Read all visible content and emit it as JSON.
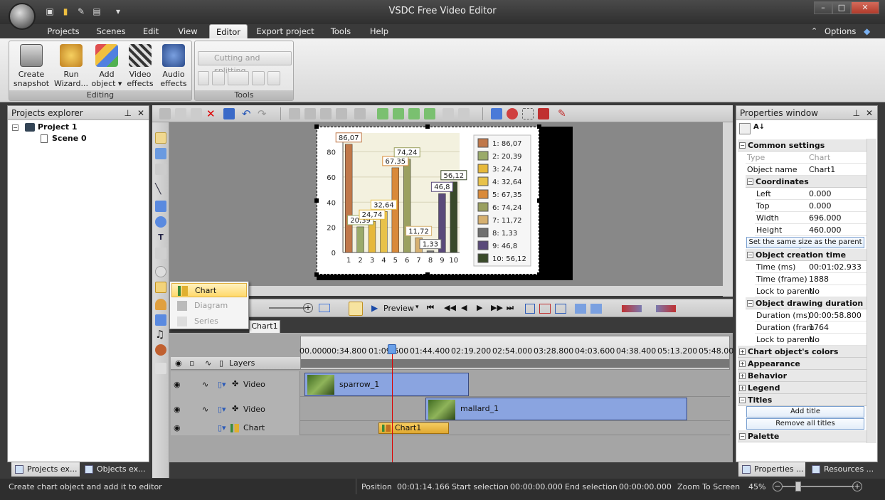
{
  "window": {
    "title": "VSDC Free Video Editor"
  },
  "menu": {
    "tabs": [
      "Projects",
      "Scenes",
      "Edit",
      "View",
      "Editor",
      "Export project",
      "Tools",
      "Help"
    ],
    "active": "Editor",
    "options": "Options"
  },
  "ribbon": {
    "editing_group": "Editing",
    "tools_group": "Tools",
    "create_snapshot": [
      "Create",
      "snapshot"
    ],
    "run_wizard": [
      "Run",
      "Wizard..."
    ],
    "add_object": [
      "Add",
      "object"
    ],
    "video_effects": [
      "Video",
      "effects"
    ],
    "audio_effects": [
      "Audio",
      "effects"
    ],
    "cutting_splitting": "Cutting and splitting"
  },
  "projects_explorer": {
    "title": "Projects explorer",
    "project": "Project 1",
    "scene": "Scene 0",
    "tabs": [
      "Projects ex...",
      "Objects ex..."
    ]
  },
  "popup_menu": {
    "items": [
      {
        "label": "Chart",
        "state": "highlighted"
      },
      {
        "label": "Diagram",
        "state": "disabled"
      },
      {
        "label": "Series",
        "state": "disabled"
      }
    ]
  },
  "chart_data": {
    "type": "bar",
    "categories": [
      "1",
      "2",
      "3",
      "4",
      "5",
      "6",
      "7",
      "8",
      "9",
      "10"
    ],
    "values": [
      86.07,
      20.39,
      24.74,
      32.64,
      67.35,
      74.24,
      11.72,
      1.33,
      46.8,
      56.12
    ],
    "data_labels": [
      "86,07",
      "20,39",
      "24,74",
      "32,64",
      "67,35",
      "74,24",
      "11,72",
      "1,33",
      "46,8",
      "56,12"
    ],
    "legend": [
      "1: 86,07",
      "2: 20,39",
      "3: 24,74",
      "4: 32,64",
      "5: 67,35",
      "6: 74,24",
      "7: 11,72",
      "8: 1,33",
      "9: 46,8",
      "10: 56,12"
    ],
    "colors": [
      "#c0784a",
      "#9aaa6a",
      "#e6b83a",
      "#e8c24a",
      "#d98a3a",
      "#9aa060",
      "#d6b070",
      "#707070",
      "#5a4a7a",
      "#3a4a2a"
    ],
    "yticks": [
      "0",
      "20",
      "40",
      "60",
      "80"
    ],
    "ylim": [
      0,
      95
    ],
    "grid": true,
    "legend_position": "right"
  },
  "timeline": {
    "preview": "Preview",
    "tab": "Chart1",
    "ruler": [
      "00.000",
      "00:34.800",
      "01:09.600",
      "01:44.400",
      "02:19.200",
      "02:54.000",
      "03:28.800",
      "04:03.600",
      "04:38.400",
      "05:13.200",
      "05:48.00"
    ],
    "layers_label": "Layers",
    "tracks": [
      {
        "label": "Video",
        "clip": "sparrow_1"
      },
      {
        "label": "Video",
        "clip": "mallard_1"
      },
      {
        "label": "Chart",
        "clip": "Chart1"
      }
    ]
  },
  "properties": {
    "title": "Properties window",
    "common": "Common settings",
    "type_k": "Type",
    "type_v": "Chart",
    "name_k": "Object name",
    "name_v": "Chart1",
    "coords": "Coordinates",
    "left_k": "Left",
    "left_v": "0.000",
    "top_k": "Top",
    "top_v": "0.000",
    "width_k": "Width",
    "width_v": "696.000",
    "height_k": "Height",
    "height_v": "460.000",
    "same_size_btn": "Set the same size as the parent has",
    "creation": "Object creation time",
    "time_ms_k": "Time (ms)",
    "time_ms_v": "00:01:02.933",
    "time_fr_k": "Time (frame)",
    "time_fr_v": "1888",
    "lock1_k": "Lock to parent",
    "lock1_v": "No",
    "duration": "Object drawing duration",
    "dur_ms_k": "Duration (ms)",
    "dur_ms_v": "00:00:58.800",
    "dur_fr_k": "Duration (fram",
    "dur_fr_v": "1764",
    "lock2_k": "Lock to parent",
    "lock2_v": "No",
    "chart_colors": "Chart object's colors",
    "appearance": "Appearance",
    "behavior": "Behavior",
    "legend": "Legend",
    "titles": "Titles",
    "add_title": "Add title",
    "remove_titles": "Remove all titles",
    "palette": "Palette",
    "tabs": [
      "Properties ...",
      "Resources ..."
    ]
  },
  "status": {
    "hint": "Create chart object and add it to editor",
    "position_k": "Position",
    "position_v": "00:01:14.166",
    "start_k": "Start selection",
    "start_v": "00:00:00.000",
    "end_k": "End selection",
    "end_v": "00:00:00.000",
    "zoom_to_screen": "Zoom To Screen",
    "zoom": "45%"
  }
}
